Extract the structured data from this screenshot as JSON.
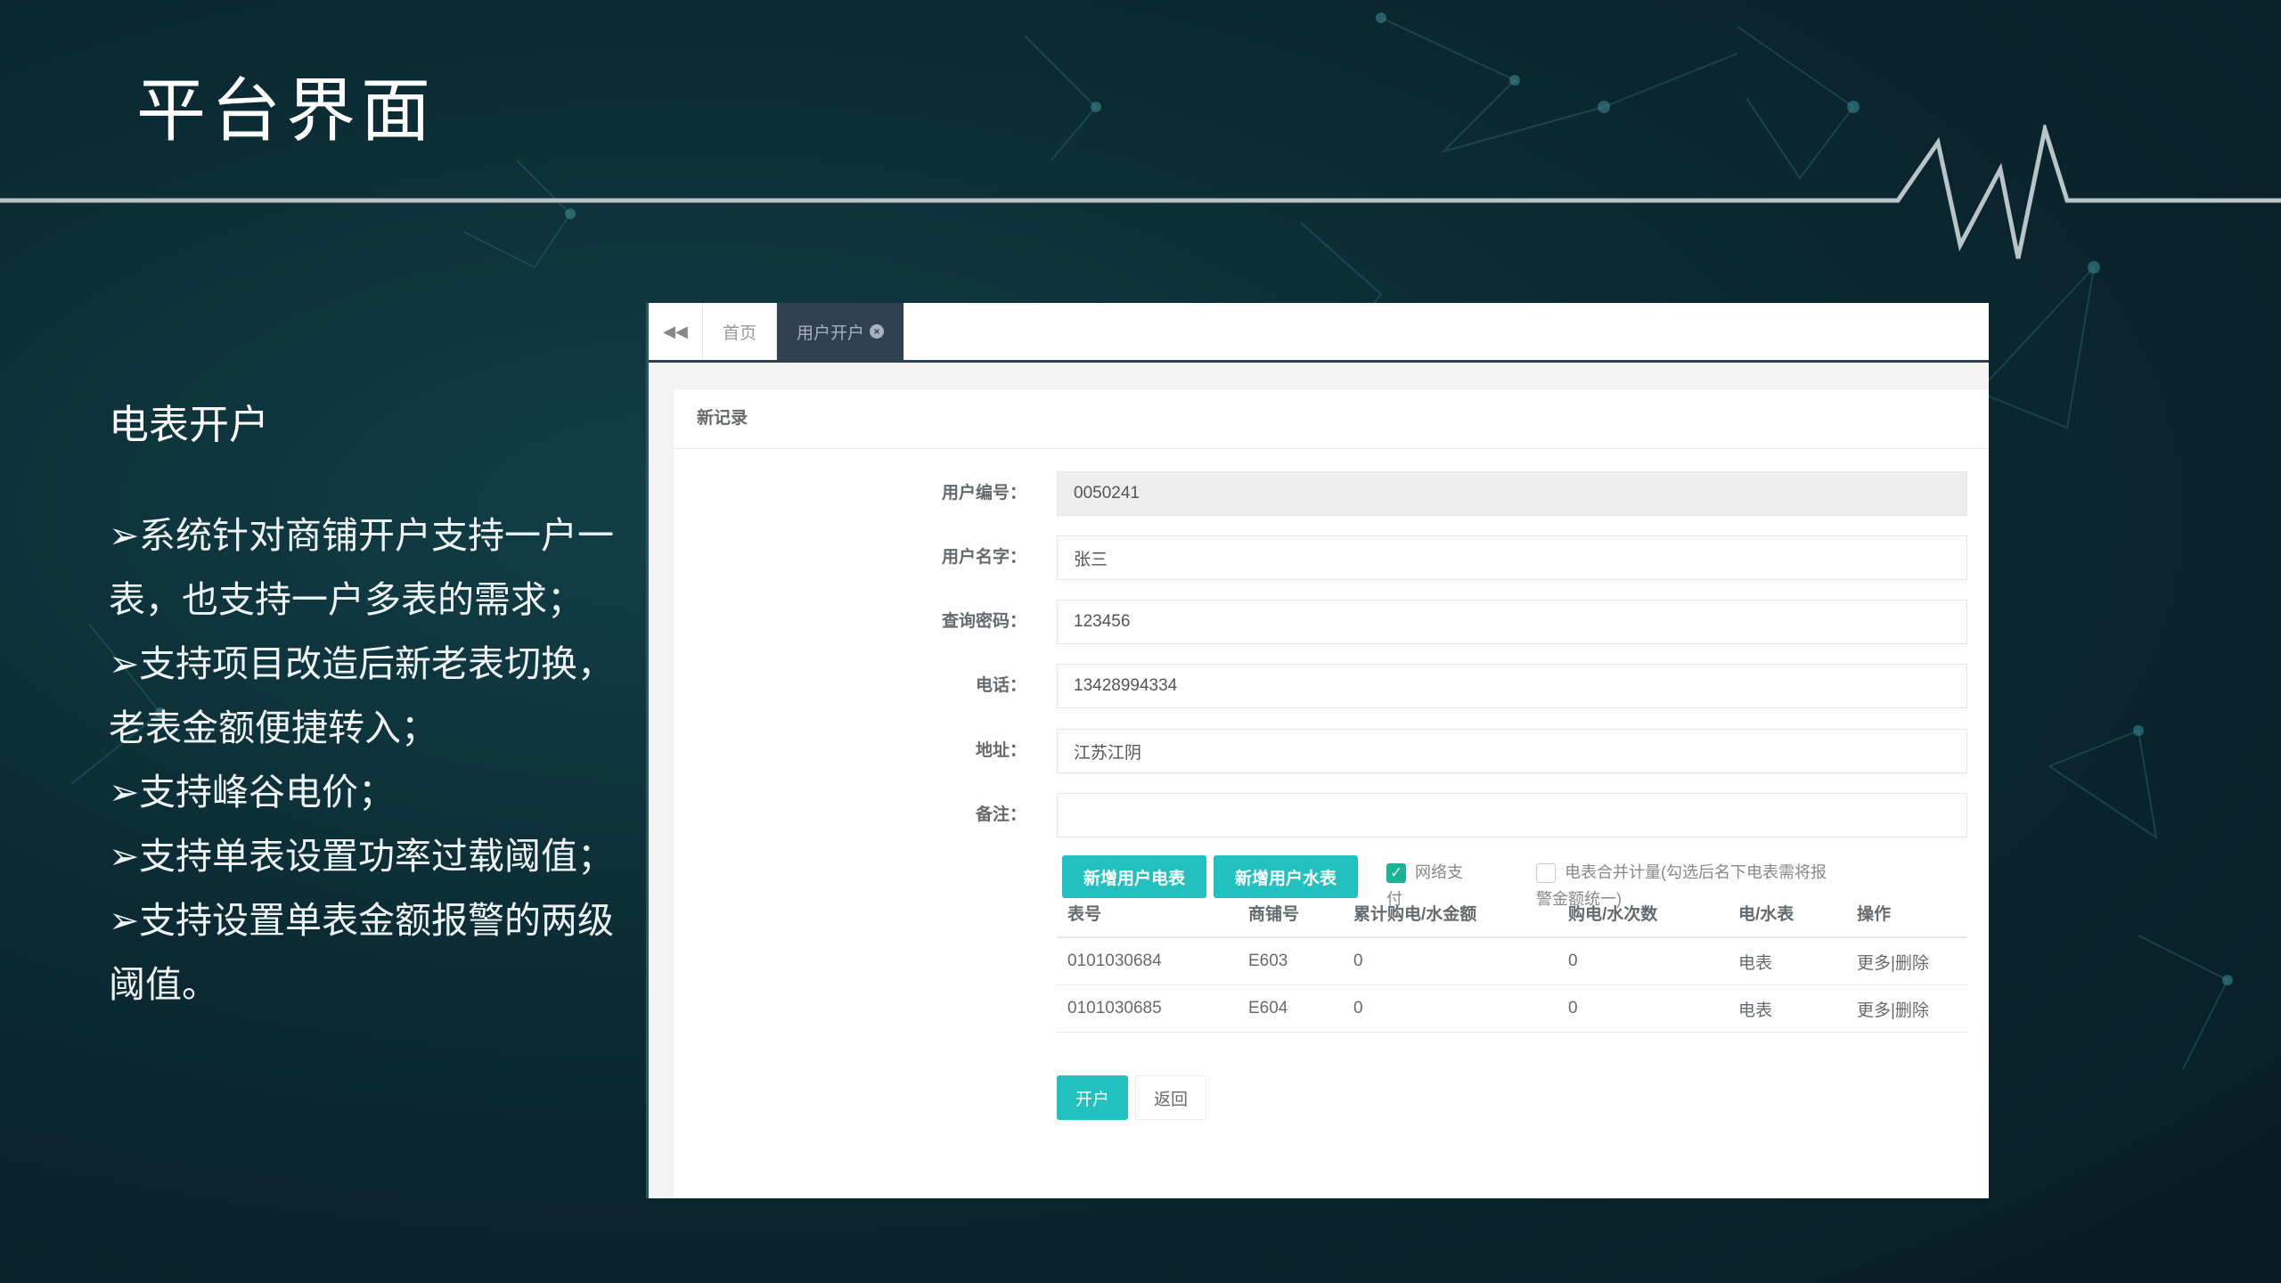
{
  "slide": {
    "title": "平台界面",
    "subtitle": "电表开户",
    "bullet_marker": "➢",
    "bullets": [
      "系统针对商铺开户支持一户一",
      "表，也支持一户多表的需求；",
      "支持项目改造后新老表切换，",
      "老表金额便捷转入；",
      "支持峰谷电价；",
      "支持单表设置功率过载阈值；",
      "支持设置单表金额报警的两级",
      "阈值。"
    ]
  },
  "app": {
    "tabs": {
      "back_icon": "double-chevron-left",
      "home": "首页",
      "active": "用户开户",
      "close_icon": "×"
    },
    "panel_title": "新记录",
    "form": {
      "user_id": {
        "label": "用户编号：",
        "value": "0050241"
      },
      "user_name": {
        "label": "用户名字：",
        "value": "张三"
      },
      "password": {
        "label": "查询密码：",
        "value": "123456"
      },
      "phone": {
        "label": "电话：",
        "value": "13428994334"
      },
      "address": {
        "label": "地址：",
        "value": "江苏江阴"
      },
      "remark": {
        "label": "备注：",
        "value": ""
      }
    },
    "buttons": {
      "add_electric": "新增用户电表",
      "add_water": "新增用户水表",
      "open": "开户",
      "back": "返回"
    },
    "checks": {
      "online_pay_line1": "网络支",
      "online_pay_line2": "付",
      "merge_line1": "电表合并计量(勾选后名下电表需将报",
      "merge_line2": "警金额统一)"
    },
    "table": {
      "headers": [
        "表号",
        "商铺号",
        "累计购电/水金额",
        "购电/水次数",
        "电/水表",
        "操作"
      ],
      "rows": [
        [
          "0101030684",
          "E603",
          "0",
          "0",
          "电表",
          "更多|删除"
        ],
        [
          "0101030685",
          "E604",
          "0",
          "0",
          "电表",
          "更多|删除"
        ]
      ]
    },
    "colors": {
      "accent": "#23c0c0",
      "tab_active": "#2f4050",
      "link": "#337ab7"
    }
  }
}
